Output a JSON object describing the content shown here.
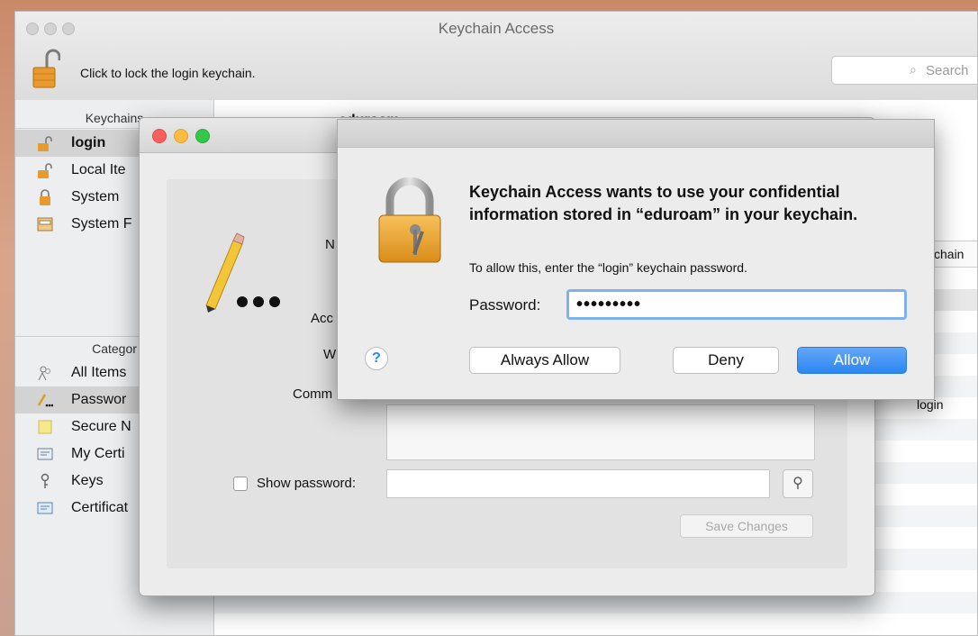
{
  "window": {
    "title": "Keychain Access",
    "lock_label": "Click to lock the login keychain.",
    "search_placeholder": "Search"
  },
  "sidebar": {
    "keychains_header": "Keychains",
    "keychains": [
      {
        "label": "login",
        "icon": "unlocked-padlock-icon",
        "selected": true
      },
      {
        "label": "Local Ite",
        "icon": "unlocked-padlock-icon"
      },
      {
        "label": "System",
        "icon": "locked-padlock-icon"
      },
      {
        "label": "System F",
        "icon": "cabinet-icon"
      }
    ],
    "category_header": "Categor",
    "categories": [
      {
        "label": "All Items",
        "icon": "people-icon"
      },
      {
        "label": "Passwor",
        "icon": "pencil-dots-icon",
        "selected": true
      },
      {
        "label": "Secure N",
        "icon": "note-icon"
      },
      {
        "label": "My Certi",
        "icon": "certificate-icon"
      },
      {
        "label": "Keys",
        "icon": "key-icon"
      },
      {
        "label": "Certificat",
        "icon": "certificate-icon"
      }
    ]
  },
  "table": {
    "column_fragment": "chain",
    "cell_fragment": "login",
    "item_name_fragment": "eduroam"
  },
  "item_window": {
    "labels": {
      "name": "N",
      "account": "Acc",
      "where": "W",
      "comments": "Comm",
      "show_password": "Show password:"
    },
    "save_button": "Save Changes",
    "password_field_value": ""
  },
  "dialog": {
    "heading": "Keychain Access wants to use your confidential information stored in “eduroam” in your keychain.",
    "info": "To allow this, enter the “login” keychain password.",
    "password_label": "Password:",
    "password_value": "•••••••••",
    "help": "?",
    "buttons": {
      "always_allow": "Always Allow",
      "deny": "Deny",
      "allow": "Allow"
    }
  },
  "colors": {
    "accent_blue": "#2c86f1",
    "focus_ring": "#7fb2ec",
    "close_red": "#fc605c",
    "minimize_yellow": "#fdbc40",
    "zoom_green": "#34c84a"
  }
}
